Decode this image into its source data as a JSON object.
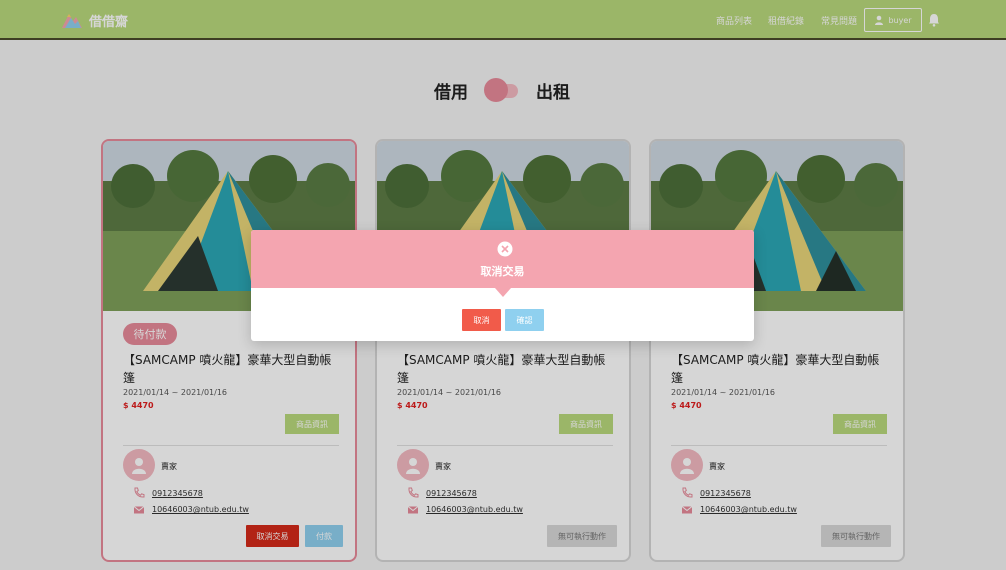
{
  "header": {
    "brand": "借借齋",
    "nav": [
      "商品列表",
      "租借紀錄",
      "常見問題"
    ],
    "username": "buyer"
  },
  "toggle": {
    "left_label": "借用",
    "right_label": "出租"
  },
  "cards": [
    {
      "status": "待付款",
      "title": "【SAMCAMP 噴火龍】豪華大型自動帳篷",
      "date_range": "2021/01/14 ~ 2021/01/16",
      "price": "$ 4470",
      "info_button": "商品資訊",
      "seller_label": "賣家",
      "phone": "0912345678",
      "email": "10646003@ntub.edu.tw",
      "actions": [
        "取消交易",
        "付款"
      ]
    },
    {
      "status": "",
      "title": "【SAMCAMP 噴火龍】豪華大型自動帳篷",
      "date_range": "2021/01/14 ~ 2021/01/16",
      "price": "$ 4470",
      "info_button": "商品資訊",
      "seller_label": "賣家",
      "phone": "0912345678",
      "email": "10646003@ntub.edu.tw",
      "actions": [
        "無可執行動作"
      ]
    },
    {
      "status": "",
      "title": "【SAMCAMP 噴火龍】豪華大型自動帳篷",
      "date_range": "2021/01/14 ~ 2021/01/16",
      "price": "$ 4470",
      "info_button": "商品資訊",
      "seller_label": "賣家",
      "phone": "0912345678",
      "email": "10646003@ntub.edu.tw",
      "actions": [
        "無可執行動作"
      ]
    }
  ],
  "modal": {
    "title": "取消交易",
    "cancel_label": "取消",
    "confirm_label": "確認"
  },
  "colors": {
    "header": "#b9d97c",
    "accent_pink": "#e88b9a",
    "modal_header": "#f4a5b0",
    "cancel_red": "#d42a1a",
    "pay_blue": "#8fd0ef",
    "price_red": "#e01f1f"
  },
  "icons": {
    "logo": "mountain-logo-icon",
    "user": "user-icon",
    "bell": "bell-icon",
    "avatar": "person-avatar-icon",
    "phone": "phone-icon",
    "email": "mail-icon",
    "modal": "close-circle-icon"
  }
}
